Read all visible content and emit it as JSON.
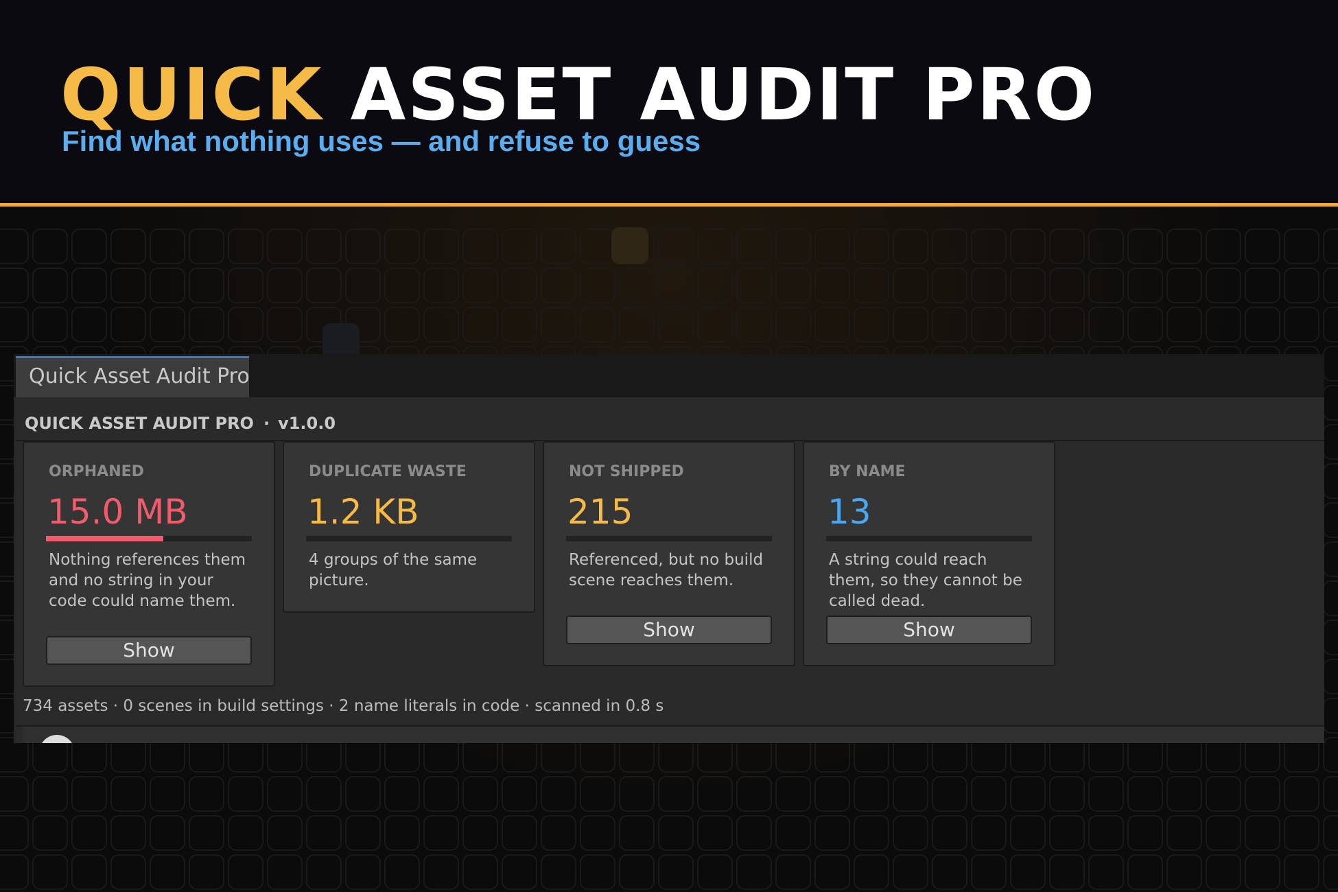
{
  "banner": {
    "title_highlight": "QUICK",
    "title_rest": "ASSET AUDIT PRO",
    "subtitle": "Find what nothing uses — and refuse to guess"
  },
  "window": {
    "tab_label": "Quick Asset Audit Pro",
    "header_title": "QUICK ASSET AUDIT PRO",
    "header_separator": "·",
    "version": "v1.0.0"
  },
  "cards": [
    {
      "label": "ORPHANED",
      "value": "15.0 MB",
      "value_color": "#f25b6b",
      "bar_fraction": 0.57,
      "bar_color": "#f25b6b",
      "description": "Nothing references them and no string in your code could name them.",
      "button_label": "Show"
    },
    {
      "label": "DUPLICATE WASTE",
      "value": "1.2 KB",
      "value_color": "#f6bb47",
      "bar_fraction": 0,
      "bar_color": "#f6bb47",
      "description": "4 groups of the same picture."
    },
    {
      "label": "NOT SHIPPED",
      "value": "215",
      "value_color": "#f6bb47",
      "bar_fraction": 0,
      "bar_color": "#f6bb47",
      "description": "Referenced, but no build scene reaches them.",
      "button_label": "Show"
    },
    {
      "label": "BY NAME",
      "value": "13",
      "value_color": "#4aa8f0",
      "bar_fraction": 0,
      "bar_color": "#4aa8f0",
      "description": "A string could reach them, so they cannot be called dead.",
      "button_label": "Show"
    }
  ],
  "status_line": "734 assets · 0 scenes in build settings · 2 name literals in code · scanned in 0.8 s",
  "colors": {
    "accent_gold": "#f6bb47",
    "accent_blue": "#5aaef0",
    "divider_orange": "#f3ae36"
  }
}
